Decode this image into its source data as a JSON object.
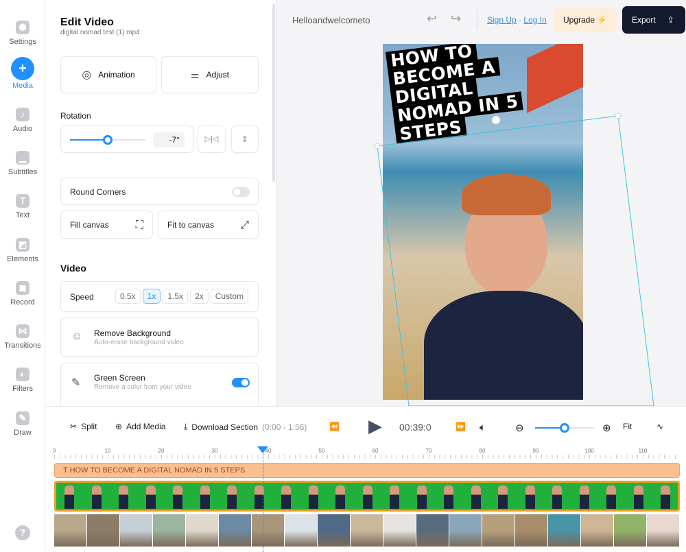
{
  "sidebar": {
    "items": [
      {
        "label": "Settings",
        "icon": "gear-icon"
      },
      {
        "label": "Media",
        "icon": "plus-icon",
        "active": true
      },
      {
        "label": "Audio",
        "icon": "music-icon"
      },
      {
        "label": "Subtitles",
        "icon": "subtitles-icon"
      },
      {
        "label": "Text",
        "icon": "text-icon"
      },
      {
        "label": "Elements",
        "icon": "elements-icon"
      },
      {
        "label": "Record",
        "icon": "record-icon"
      },
      {
        "label": "Transitions",
        "icon": "transitions-icon"
      },
      {
        "label": "Filters",
        "icon": "filters-icon"
      },
      {
        "label": "Draw",
        "icon": "pencil-icon"
      }
    ],
    "help": "?"
  },
  "panel": {
    "title": "Edit Video",
    "filename": "digital nomad test (1).mp4",
    "animation": "Animation",
    "adjust": "Adjust",
    "rotation_label": "Rotation",
    "rotation_value": "-7°",
    "rotation_slider_fraction": 0.5,
    "round_corners": "Round Corners",
    "round_corners_on": false,
    "fill_canvas": "Fill canvas",
    "fit_to_canvas": "Fit to canvas",
    "video_heading": "Video",
    "speed_label": "Speed",
    "speeds": [
      "0.5x",
      "1x",
      "1.5x",
      "2x",
      "Custom"
    ],
    "speed_selected": "1x",
    "remove_bg_title": "Remove Background",
    "remove_bg_sub": "Auto-erase background video",
    "green_title": "Green Screen",
    "green_sub": "Remove a color from your video",
    "green_on": true
  },
  "header": {
    "project_name": "Helloandwelcometo",
    "sign_up": "Sign Up",
    "separator": "·",
    "log_in": "Log In",
    "upgrade": "Upgrade",
    "export": "Export"
  },
  "preview": {
    "caption_lines": [
      "HOW TO",
      "BECOME A",
      "DIGITAL",
      "NOMAD IN 5",
      "STEPS"
    ]
  },
  "timeline": {
    "split": "Split",
    "add_media": "Add Media",
    "download": "Download Section",
    "download_range": "(0:00 - 1:56)",
    "time": "00:39:0",
    "fit": "Fit",
    "zoom_fraction": 0.5,
    "ticks": [
      "0",
      "10",
      "20",
      "30",
      "40",
      "50",
      "60",
      "70",
      "80",
      "90",
      "100",
      "110"
    ],
    "playhead_seconds": 39,
    "text_track": "HOW TO BECOME A DIGITAL NOMAD IN 5 STEPS",
    "accent": "#1e90ff",
    "text_track_color": "#fcc08f",
    "video_track_color": "#22b03c"
  }
}
